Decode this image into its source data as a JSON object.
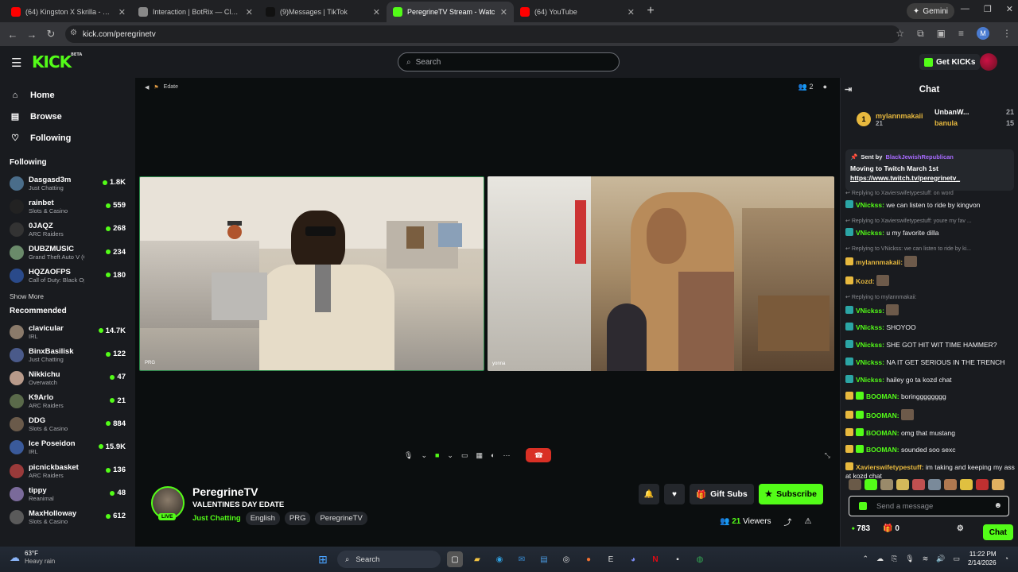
{
  "browser": {
    "tabs": [
      {
        "title": "(64) Kingston X Skrilla - YouTub",
        "color": "#ff0000"
      },
      {
        "title": "Interaction | BotRix — Cloud St",
        "color": "#888888"
      },
      {
        "title": "(9)Messages | TikTok",
        "color": "#111111"
      },
      {
        "title": "PeregrineTV Stream - Watc",
        "color": "#53fc18"
      },
      {
        "title": "(64) YouTube",
        "color": "#ff0000"
      }
    ],
    "gemini_label": "Gemini",
    "url": "kick.com/peregrinetv",
    "profile_initial": "M"
  },
  "topnav": {
    "logo": "KICK",
    "logo_badge": "BETA",
    "search_placeholder": "Search",
    "get_kicks": "Get KICKs"
  },
  "sidebar": {
    "nav": [
      {
        "label": "Home",
        "icon": "home-icon"
      },
      {
        "label": "Browse",
        "icon": "browse-icon"
      },
      {
        "label": "Following",
        "icon": "heart-icon"
      }
    ],
    "following_title": "Following",
    "following": [
      {
        "name": "Dasgasd3m",
        "category": "Just Chatting",
        "viewers": "1.8K",
        "color": "#4a6d8a"
      },
      {
        "name": "rainbet",
        "category": "Slots & Casino",
        "viewers": "559",
        "color": "#222222"
      },
      {
        "name": "0JAQZ",
        "category": "ARC Raiders",
        "viewers": "268",
        "color": "#333333"
      },
      {
        "name": "DUBZMUSIC",
        "category": "Grand Theft Auto V (G...",
        "viewers": "234",
        "color": "#6a8a6a"
      },
      {
        "name": "HQZAOFPS",
        "category": "Call of Duty: Black Ops...",
        "viewers": "180",
        "color": "#2a4a8a"
      }
    ],
    "show_more": "Show More",
    "recommended_title": "Recommended",
    "recommended": [
      {
        "name": "clavicular",
        "category": "IRL",
        "viewers": "14.7K",
        "color": "#8a7a6a"
      },
      {
        "name": "BinxBasilisk",
        "category": "Just Chatting",
        "viewers": "122",
        "color": "#4a5a8a"
      },
      {
        "name": "Nikkichu",
        "category": "Overwatch",
        "viewers": "47",
        "color": "#b89a8a"
      },
      {
        "name": "K9Arlo",
        "category": "ARC Raiders",
        "viewers": "21",
        "color": "#5a6a4a"
      },
      {
        "name": "DDG",
        "category": "Slots & Casino",
        "viewers": "884",
        "color": "#6a5a4a"
      },
      {
        "name": "Ice Poseidon",
        "category": "IRL",
        "viewers": "15.9K",
        "color": "#3a5a9a"
      },
      {
        "name": "picnickbasket",
        "category": "ARC Raiders",
        "viewers": "136",
        "color": "#9a3a3a"
      },
      {
        "name": "tippy",
        "category": "Reanimal",
        "viewers": "48",
        "color": "#7a6a9a"
      },
      {
        "name": "MaxHolloway",
        "category": "Slots & Casino",
        "viewers": "612",
        "color": "#5a5a5a"
      }
    ]
  },
  "video": {
    "top_label": "Edate",
    "participant_count": "2",
    "left_label": "PRG",
    "right_label": "yonna"
  },
  "stream": {
    "streamer": "PeregrineTV",
    "live": "LIVE",
    "title": "VALENTINES DAY EDATE",
    "category": "Just Chatting",
    "tags": [
      "English",
      "PRG",
      "PeregrineTV"
    ],
    "gift_subs": "Gift Subs",
    "subscribe": "Subscribe",
    "viewers": "21",
    "viewers_label": "Viewers"
  },
  "chat": {
    "title": "Chat",
    "leaderboard": {
      "rank": "1",
      "top_user": "mylannmakaii",
      "top_count": "21",
      "second_user": "UnbanW...",
      "second_count": "21",
      "third_user": "banula",
      "third_count": "15"
    },
    "pinned": {
      "sent_by": "Sent by",
      "user": "BlackJewishRepublican",
      "message": "Moving to Twitch March 1st",
      "link": "https://www.twitch.tv/peregrinetv_"
    },
    "messages": [
      {
        "reply": "Replying to Xavierswifetypestuff: on word",
        "user": "VNickss",
        "text": "we can listen to ride by kingvon",
        "type": "v"
      },
      {
        "reply": "Replying to Xavierswifetypestuff: youre my fav ...",
        "user": "VNickss",
        "text": "u my favorite dilla",
        "type": "v"
      },
      {
        "reply": "Replying to VNickss: we can listen to ride by ki...",
        "user": "mylannmakaii",
        "text": "",
        "type": "m",
        "emote": true
      },
      {
        "reply": "",
        "user": "Kozd",
        "text": "",
        "type": "m",
        "emote": true
      },
      {
        "reply": "Replying to mylannmakaii:",
        "user": "VNickss",
        "text": "",
        "type": "v",
        "emote": true
      },
      {
        "reply": "",
        "user": "VNickss",
        "text": "SHOYOO",
        "type": "v"
      },
      {
        "reply": "",
        "user": "VNickss",
        "text": "SHE GOT HIT WIT TIME HAMMER?",
        "type": "v"
      },
      {
        "reply": "",
        "user": "VNickss",
        "text": "NA IT GET SERIOUS IN THE TRENCH",
        "type": "v"
      },
      {
        "reply": "",
        "user": "VNickss",
        "text": "hailey go ta kozd chat",
        "type": "v"
      },
      {
        "reply": "",
        "user": "BOOMAN",
        "text": "boringggggggg",
        "type": "b"
      },
      {
        "reply": "",
        "user": "BOOMAN",
        "text": "",
        "type": "b",
        "emote": true
      },
      {
        "reply": "",
        "user": "BOOMAN",
        "text": "omg that mustang",
        "type": "b"
      },
      {
        "reply": "",
        "user": "BOOMAN",
        "text": "sounded soo sexc",
        "type": "b"
      },
      {
        "reply": "",
        "user": "Xavierswifetypestuff",
        "text": "im taking and keeping my ass at kozd chat",
        "type": "x"
      }
    ],
    "input_placeholder": "Send a message",
    "points": "783",
    "drops": "0",
    "send": "Chat"
  },
  "taskbar": {
    "temp": "63°F",
    "weather": "Heavy rain",
    "search": "Search",
    "time": "11:22 PM",
    "date": "2/14/2026"
  }
}
